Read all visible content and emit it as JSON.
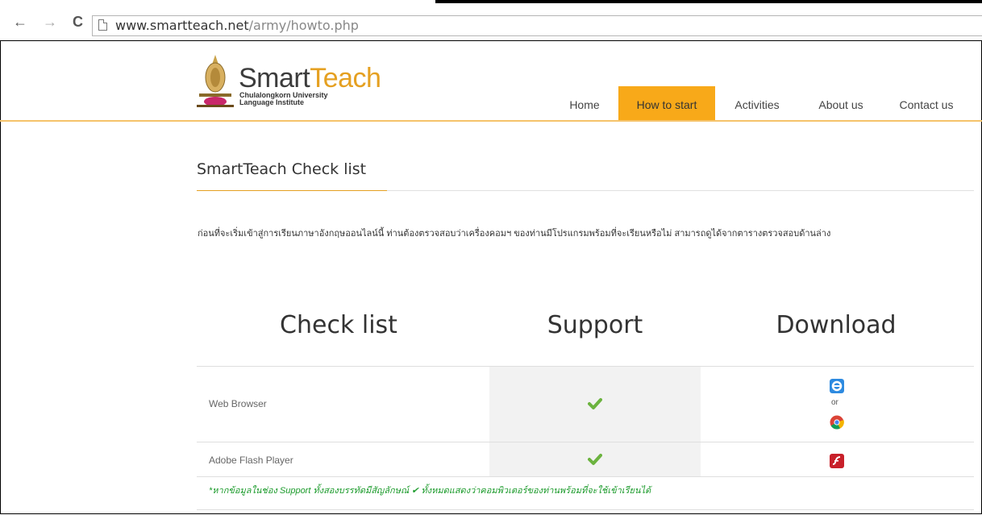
{
  "browser": {
    "back_icon": "←",
    "forward_icon": "→",
    "reload_icon": "C",
    "url_host": "www.smartteach.net",
    "url_path": "/army/howto.php"
  },
  "site": {
    "logo_part1": "Smart",
    "logo_part2": "Teach",
    "logo_sub1": "Chulalongkorn University",
    "logo_sub2": "Language Institute",
    "nav": [
      "Home",
      "How to start",
      "Activities",
      "About us",
      "Contact us"
    ],
    "accent_color": "#f8a919"
  },
  "content": {
    "title": "SmartTeach Check list",
    "intro": "ก่อนที่จะเริ่มเข้าสู่การเรียนภาษาอังกฤษออนไลน์นี้ ท่านต้องตรวจสอบว่าเครื่องคอมฯ ของท่านมีโปรแกรมพร้อมที่จะเรียนหรือไม่ สามารถดูได้จากตารางตรวจสอบด้านล่าง",
    "table": {
      "headers": [
        "Check list",
        "Support",
        "Download"
      ],
      "rows": [
        {
          "label": "Web Browser",
          "supported": true,
          "download_icons": [
            "ie-icon",
            "chrome-icon"
          ],
          "or_text": "or"
        },
        {
          "label": "Adobe Flash Player",
          "supported": true,
          "download_icons": [
            "flash-icon"
          ]
        }
      ]
    },
    "note": "*หากข้อมูลในช่อง Support ทั้งสองบรรทัดมีสัญลักษณ์ ✔ ทั้งหมดแสดงว่าคอมพิวเตอร์ของท่านพร้อมที่จะใช้เข้าเรียนได้"
  }
}
